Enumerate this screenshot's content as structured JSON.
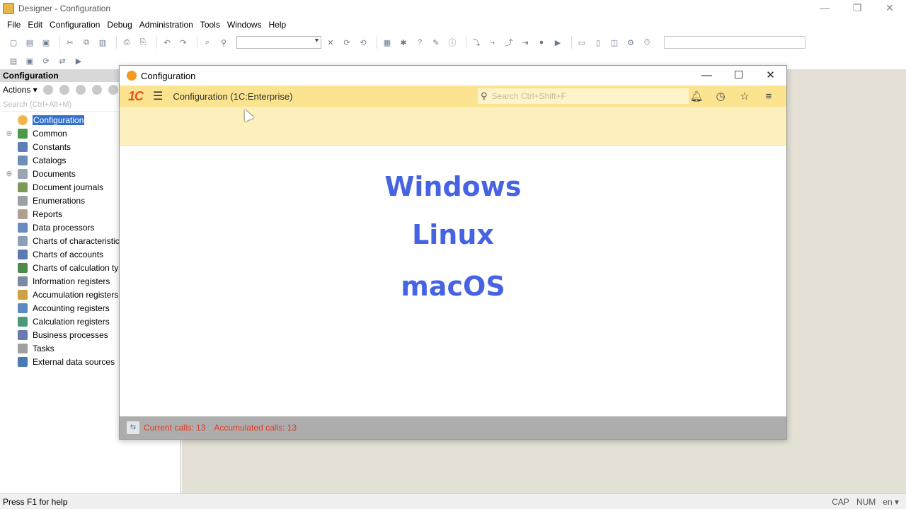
{
  "window": {
    "title": "Designer - Configuration",
    "minimize": "—",
    "restore": "❐",
    "close": "✕"
  },
  "menu": [
    "File",
    "Edit",
    "Configuration",
    "Debug",
    "Administration",
    "Tools",
    "Windows",
    "Help"
  ],
  "left_panel": {
    "header": "Configuration",
    "actions_label": "Actions ▾",
    "search_placeholder": "Search (Ctrl+Alt+M)",
    "tree": [
      {
        "label": "Configuration",
        "expander": "",
        "icon_color": "#f0b54b",
        "selected": true
      },
      {
        "label": "Common",
        "expander": "⊕",
        "icon_color": "#4a9a4a"
      },
      {
        "label": "Constants",
        "expander": "",
        "icon_color": "#5b7fb6"
      },
      {
        "label": "Catalogs",
        "expander": "",
        "icon_color": "#6e8fb5"
      },
      {
        "label": "Documents",
        "expander": "⊕",
        "icon_color": "#9aa6b3"
      },
      {
        "label": "Document journals",
        "expander": "",
        "icon_color": "#7a9a5a"
      },
      {
        "label": "Enumerations",
        "expander": "",
        "icon_color": "#9aa0a6"
      },
      {
        "label": "Reports",
        "expander": "",
        "icon_color": "#b0a090"
      },
      {
        "label": "Data processors",
        "expander": "",
        "icon_color": "#6a8ac0"
      },
      {
        "label": "Charts of characteristic types",
        "expander": "",
        "icon_color": "#8aa0b8"
      },
      {
        "label": "Charts of accounts",
        "expander": "",
        "icon_color": "#5a7ab0"
      },
      {
        "label": "Charts of calculation types",
        "expander": "",
        "icon_color": "#4a8a4a"
      },
      {
        "label": "Information registers",
        "expander": "",
        "icon_color": "#7a8aa0"
      },
      {
        "label": "Accumulation registers",
        "expander": "",
        "icon_color": "#d0a040"
      },
      {
        "label": "Accounting registers",
        "expander": "",
        "icon_color": "#5a8ac0"
      },
      {
        "label": "Calculation registers",
        "expander": "",
        "icon_color": "#4a9a7a"
      },
      {
        "label": "Business processes",
        "expander": "",
        "icon_color": "#6a7ab0"
      },
      {
        "label": "Tasks",
        "expander": "",
        "icon_color": "#a0a0a0"
      },
      {
        "label": "External data sources",
        "expander": "",
        "icon_color": "#4a7ab0"
      }
    ]
  },
  "inner_window": {
    "title": "Configuration",
    "header_title": "Configuration  (1C:Enterprise)",
    "logo": "1C",
    "search_placeholder": "Search Ctrl+Shift+F",
    "minimize": "—",
    "maximize": "☐",
    "close": "✕",
    "icons": [
      "bell-icon",
      "history-icon",
      "star-icon",
      "menu-icon"
    ],
    "os_labels": [
      "Windows",
      "Linux",
      "macOS"
    ],
    "status": {
      "current_calls": "Current calls: 13",
      "accumulated_calls": "Accumulated calls: 13"
    }
  },
  "statusbar": {
    "help": "Press F1 for help",
    "cap": "CAP",
    "num": "NUM",
    "lang": "en ▾"
  },
  "colors": {
    "accent": "#4563e3",
    "header_bg": "#fbe38f",
    "status_text": "#e33a26",
    "selection": "#3371ce"
  }
}
